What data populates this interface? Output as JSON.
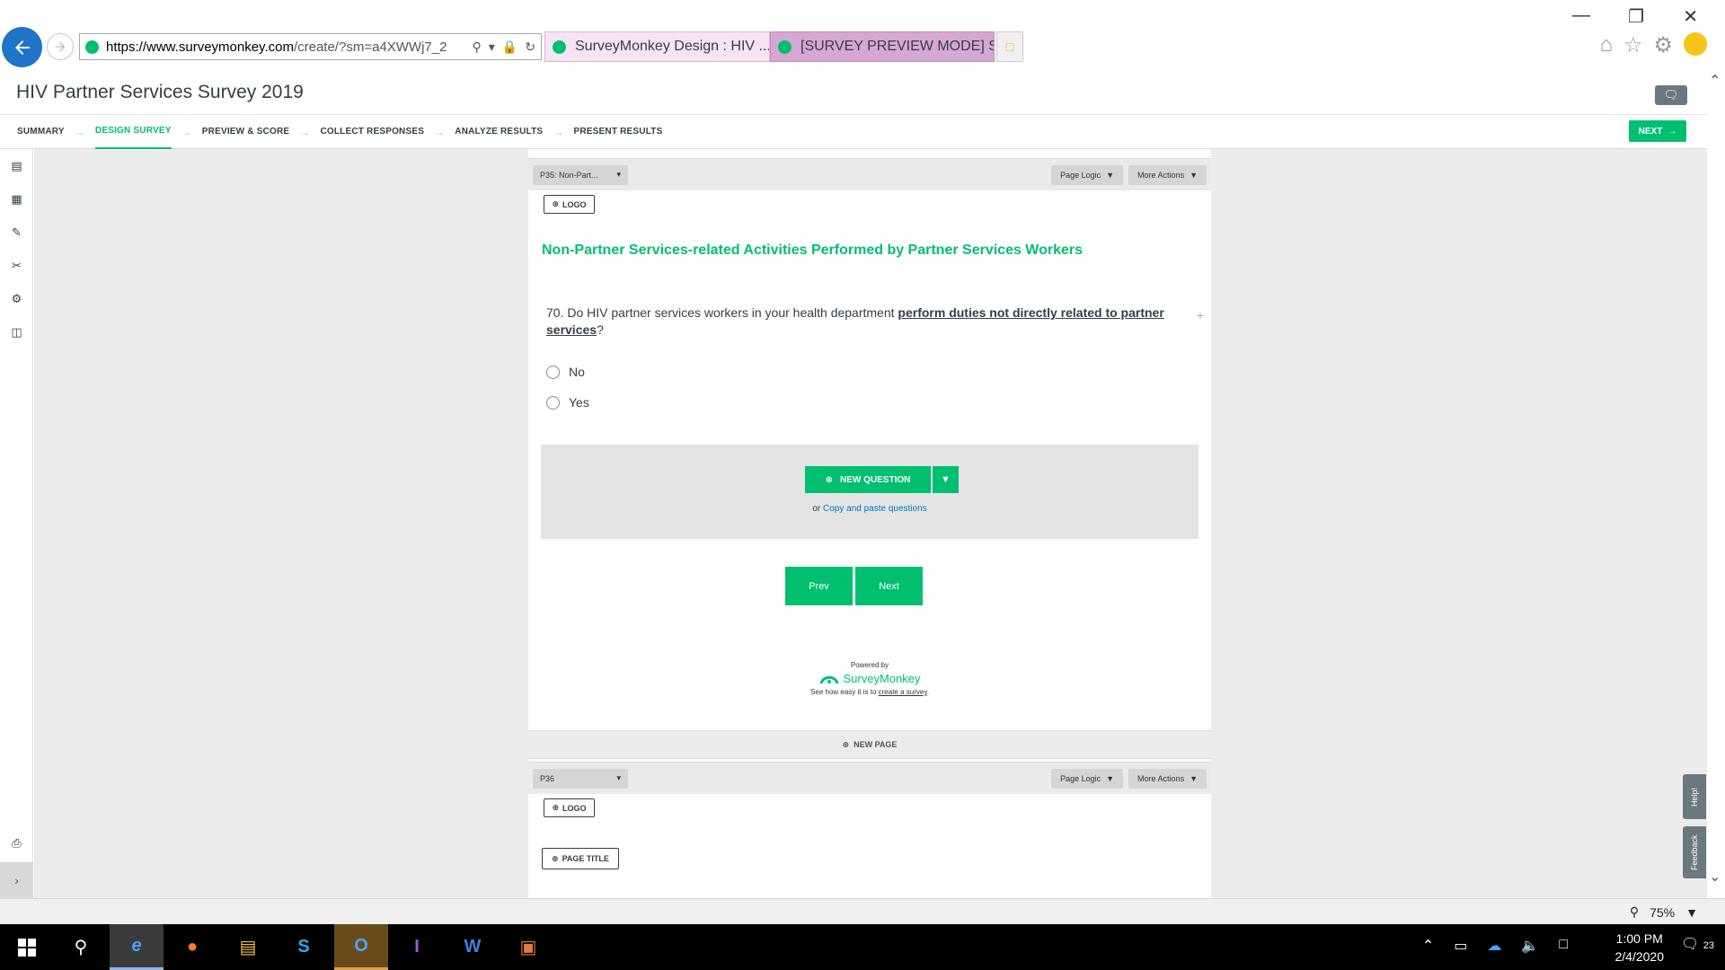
{
  "browser": {
    "url_domain": "https://www.surveymonkey.com",
    "url_rest": "/create/?sm=a4XWWj7_2",
    "tabs": [
      {
        "label": "SurveyMonkey Design : HIV ..."
      },
      {
        "label": "[SURVEY PREVIEW MODE] Surv..."
      }
    ]
  },
  "app": {
    "survey_title": "HIV Partner Services Survey 2019",
    "steps": [
      {
        "label": "SUMMARY"
      },
      {
        "label": "DESIGN SURVEY"
      },
      {
        "label": "PREVIEW & SCORE"
      },
      {
        "label": "COLLECT RESPONSES"
      },
      {
        "label": "ANALYZE RESULTS"
      },
      {
        "label": "PRESENT RESULTS"
      }
    ],
    "next_label": "NEXT"
  },
  "page35": {
    "select_label": "P35: Non-Part...",
    "page_logic": "Page Logic",
    "more_actions": "More Actions",
    "logo_label": "LOGO",
    "heading": "Non-Partner Services-related Activities Performed by Partner Services Workers",
    "question": {
      "prefix": "70. Do HIV partner services workers in your health department ",
      "emphasis": " perform duties not directly related to partner services",
      "suffix": "?",
      "options": [
        "No",
        "Yes"
      ]
    },
    "new_question_label": "NEW QUESTION",
    "copy_prefix": "or ",
    "copy_link": "Copy and paste questions",
    "prev_label": "Prev",
    "next_label": "Next",
    "powered_by": "Powered by",
    "brand": "SurveyMonkey",
    "tagline_prefix": "See how easy it is to ",
    "tagline_link": "create a survey",
    "tagline_suffix": "."
  },
  "new_page_label": "NEW PAGE",
  "page36": {
    "select_label": "P36",
    "page_logic": "Page Logic",
    "more_actions": "More Actions",
    "logo_label": "LOGO",
    "page_title_label": "PAGE TITLE"
  },
  "side_tabs": {
    "help": "Help!",
    "feedback": "Feedback"
  },
  "status": {
    "zoom": "75%"
  },
  "taskbar": {
    "time": "1:00 PM",
    "date": "2/4/2020",
    "notifications": "23"
  },
  "colors": {
    "brand_green": "#00bf6f",
    "link_blue": "#0078c1",
    "text_dark": "#333e48"
  }
}
